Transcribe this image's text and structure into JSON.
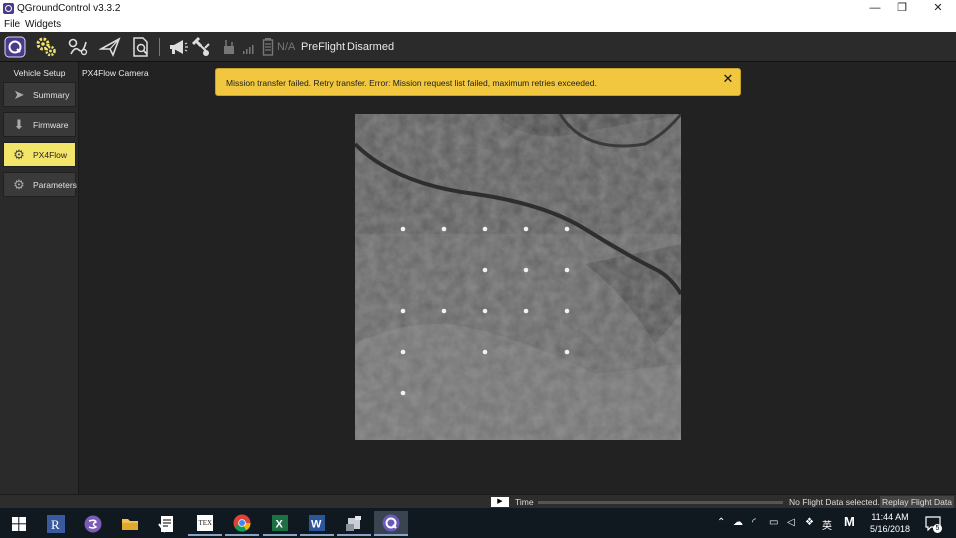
{
  "window": {
    "title": "QGroundControl v3.3.2",
    "minimize": "—",
    "restore": "❐",
    "close": "✕"
  },
  "menu": [
    "File",
    "Widgets"
  ],
  "toolbar": {
    "battery_text": "N/A",
    "flight_mode": "PreFlight",
    "arm_state": "Disarmed"
  },
  "sidebar": {
    "heading": "Vehicle Setup",
    "items": [
      {
        "label": "Summary",
        "icon": "paper-plane-icon",
        "active": false
      },
      {
        "label": "Firmware",
        "icon": "download-icon",
        "active": false
      },
      {
        "label": "PX4Flow",
        "icon": "gears-icon",
        "active": true
      },
      {
        "label": "Parameters",
        "icon": "gears-icon",
        "active": false
      }
    ]
  },
  "main": {
    "title": "PX4Flow Camera"
  },
  "alert": {
    "message": "Mission transfer failed. Retry transfer. Error: Mission request list failed, maximum retries exceeded.",
    "close": "✕",
    "color": "#f0c73f"
  },
  "statusbar": {
    "play": "▶",
    "time_label": "Time",
    "no_data": "No Flight Data selected..",
    "replay_label": "Replay Flight Data"
  },
  "taskbar": {
    "ime": "英",
    "time": "11:44 AM",
    "date": "5/16/2018",
    "notifications": "5"
  },
  "colors": {
    "accent": "#f3e56a",
    "background": "#222222",
    "alert": "#f0c73f"
  }
}
